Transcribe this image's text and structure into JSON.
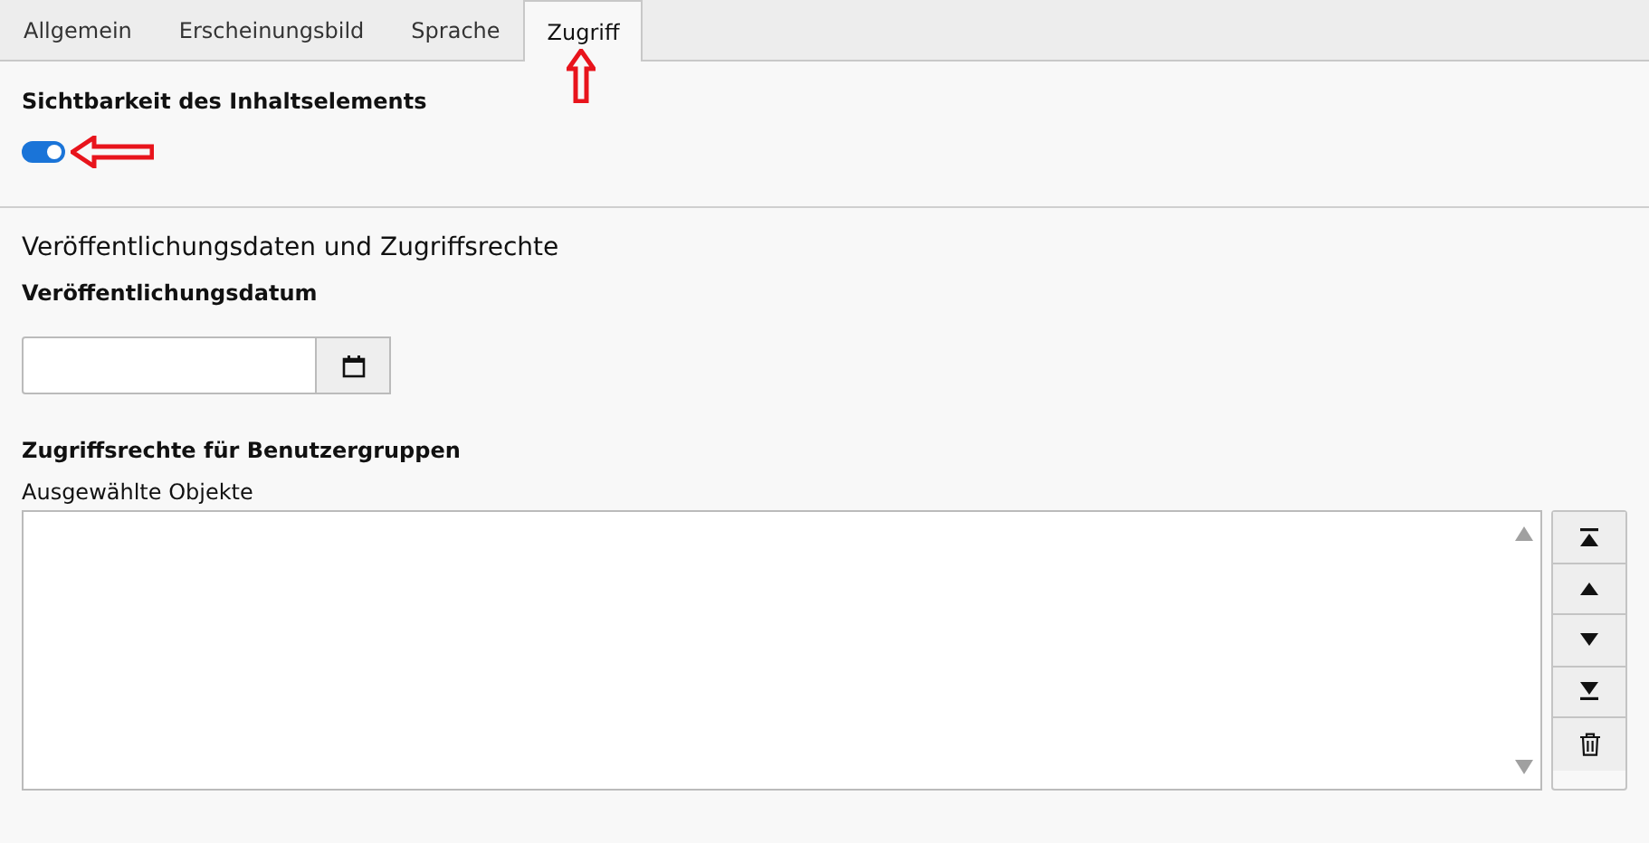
{
  "tabs": [
    {
      "label": "Allgemein",
      "selected": false
    },
    {
      "label": "Erscheinungsbild",
      "selected": false
    },
    {
      "label": "Sprache",
      "selected": false
    },
    {
      "label": "Zugriff",
      "selected": true
    }
  ],
  "visibility": {
    "label": "Sichtbarkeit des Inhaltselements",
    "on": true
  },
  "section_title": "Veröffentlichungsdaten und Zugriffsrechte",
  "date_field": {
    "label": "Veröffentlichungsdatum"
  },
  "groups": {
    "label": "Zugriffsrechte für Benutzergruppen",
    "list_label": "Ausgewählte Objekte",
    "buttons": [
      {
        "kind": "top"
      },
      {
        "kind": "up"
      },
      {
        "kind": "down"
      },
      {
        "kind": "bottom"
      },
      {
        "kind": "delete"
      }
    ]
  }
}
